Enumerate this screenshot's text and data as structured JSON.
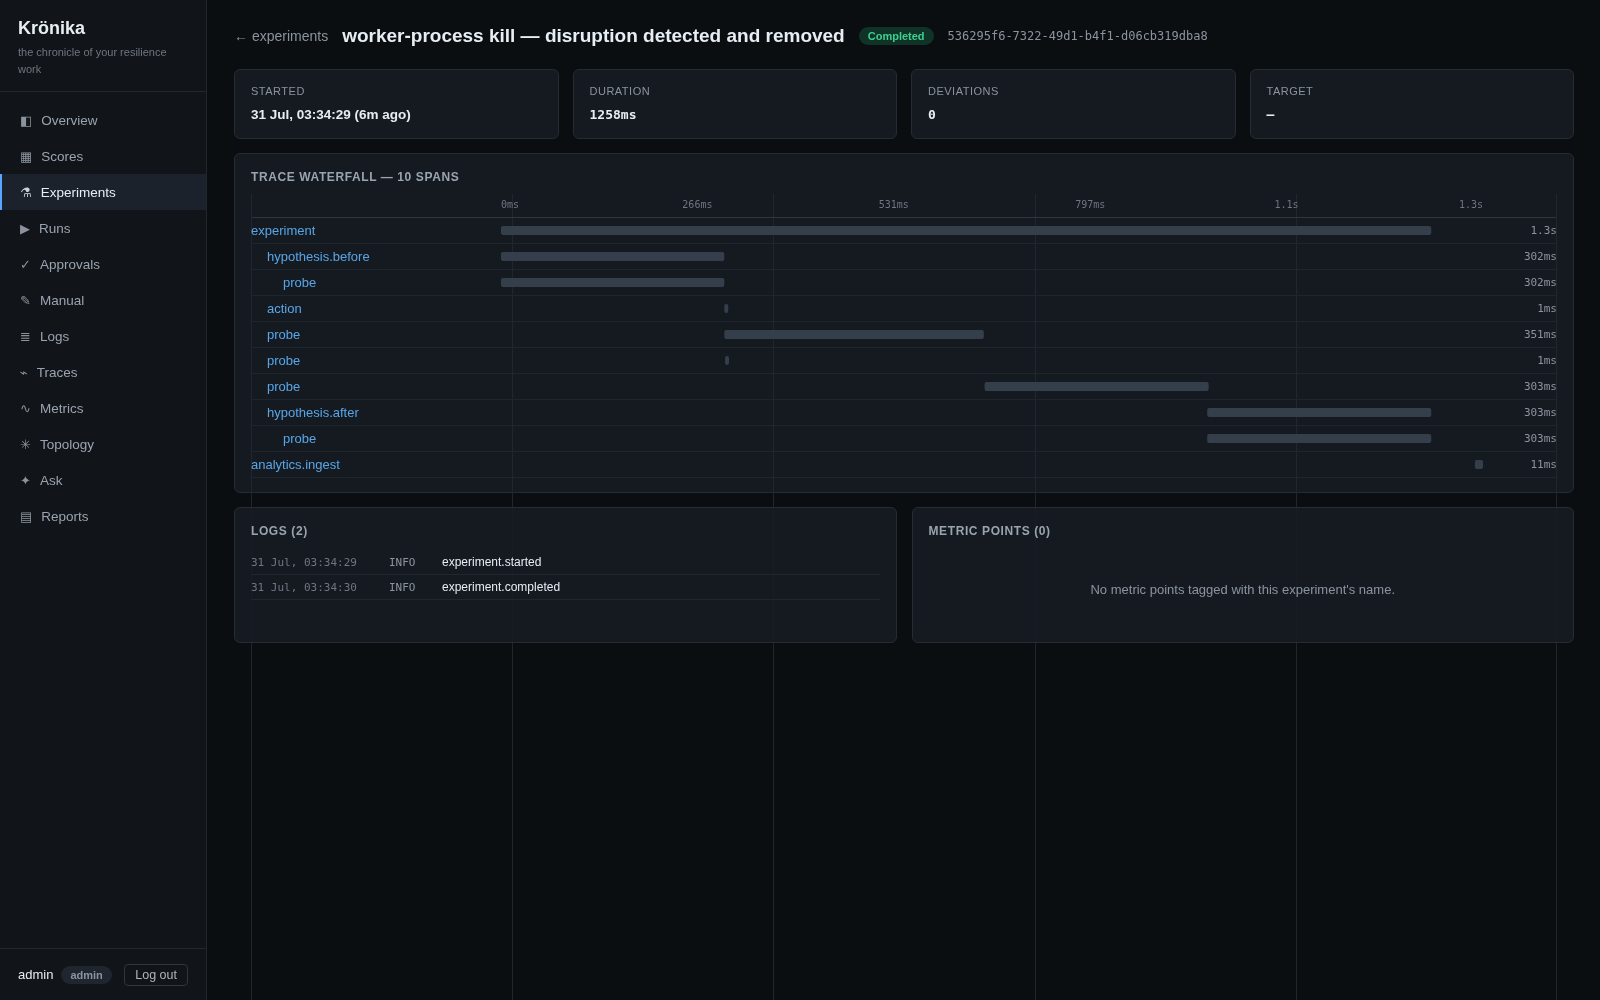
{
  "sidebar": {
    "brand": "Krönika",
    "tagline": "the chronicle of your resilience work",
    "items": [
      {
        "icon": "◧",
        "label": "Overview",
        "selected": false
      },
      {
        "icon": "▦",
        "label": "Scores",
        "selected": false
      },
      {
        "icon": "⚗",
        "label": "Experiments",
        "selected": true
      },
      {
        "icon": "▶",
        "label": "Runs",
        "selected": false
      },
      {
        "icon": "✓",
        "label": "Approvals",
        "selected": false
      },
      {
        "icon": "✎",
        "label": "Manual",
        "selected": false
      },
      {
        "icon": "≣",
        "label": "Logs",
        "selected": false
      },
      {
        "icon": "⌁",
        "label": "Traces",
        "selected": false
      },
      {
        "icon": "∿",
        "label": "Metrics",
        "selected": false
      },
      {
        "icon": "✳",
        "label": "Topology",
        "selected": false
      },
      {
        "icon": "✦",
        "label": "Ask",
        "selected": false
      },
      {
        "icon": "▤",
        "label": "Reports",
        "selected": false
      }
    ],
    "user": {
      "name": "admin",
      "role": "admin",
      "logout": "Log out"
    }
  },
  "header": {
    "back_link": "← experiments",
    "title": "worker-process kill — disruption detected and removed",
    "status": "Completed",
    "run_id": "536295f6-7322-49d1-b4f1-d06cb319dba8"
  },
  "stats": [
    {
      "label": "STARTED",
      "value": "31 Jul, 03:34:29 (6m ago)",
      "kind": "text"
    },
    {
      "label": "DURATION",
      "value": "1258ms",
      "kind": "code"
    },
    {
      "label": "DEVIATIONS",
      "value": "0",
      "kind": "code"
    },
    {
      "label": "TARGET",
      "value": "—",
      "kind": "code"
    }
  ],
  "waterfall": {
    "title": "TRACE WATERFALL — 10 SPANS",
    "axis_labels": [
      "0ms",
      "266ms",
      "531ms",
      "797ms",
      "1.1s",
      "1.3s"
    ],
    "spans": [
      {
        "name": "experiment",
        "duration": "1.3s",
        "children": [
          {
            "name": "hypothesis.before",
            "duration": "302ms",
            "children": [
              {
                "name": "probe",
                "duration": "302ms"
              }
            ]
          },
          {
            "name": "action",
            "duration": "1ms"
          },
          {
            "name": "probe",
            "duration": "351ms"
          },
          {
            "name": "probe",
            "duration": "1ms"
          },
          {
            "name": "probe",
            "duration": "303ms"
          },
          {
            "name": "hypothesis.after",
            "duration": "303ms",
            "children": [
              {
                "name": "probe",
                "duration": "303ms"
              }
            ]
          }
        ]
      },
      {
        "name": "analytics.ingest",
        "duration": "11ms"
      }
    ]
  },
  "logs": {
    "title": "LOGS (2)",
    "rows": [
      {
        "time": "31 Jul, 03:34:29",
        "severity": "INFO",
        "message": "experiment.started"
      },
      {
        "time": "31 Jul, 03:34:30",
        "severity": "INFO",
        "message": "experiment.completed"
      }
    ]
  },
  "metric_points": {
    "title": "METRIC POINTS (0)",
    "empty_message": "No metric points tagged with this experiment's name."
  }
}
